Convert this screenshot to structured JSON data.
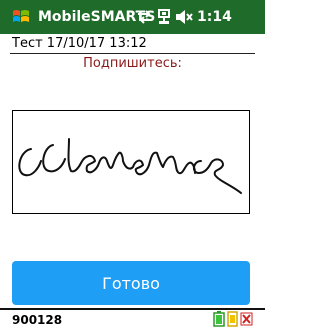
{
  "titlebar": {
    "app_name": "MobileSMARTS",
    "clock": "1:14",
    "icons": [
      "windows-logo-icon",
      "network-sync-icon",
      "device-icon",
      "speaker-muted-icon"
    ]
  },
  "header": {
    "text": "Тест 17/10/17 13:12"
  },
  "signature": {
    "prompt": "Подпишитесь:"
  },
  "actions": {
    "done_label": "Готово"
  },
  "footer": {
    "code": "900128",
    "icons": [
      "battery-icon",
      "connection-status-icon",
      "close-icon"
    ]
  },
  "colors": {
    "titlebar": "#1f6b29",
    "prompt": "#8b1a1a",
    "button": "#1e9ef4"
  }
}
